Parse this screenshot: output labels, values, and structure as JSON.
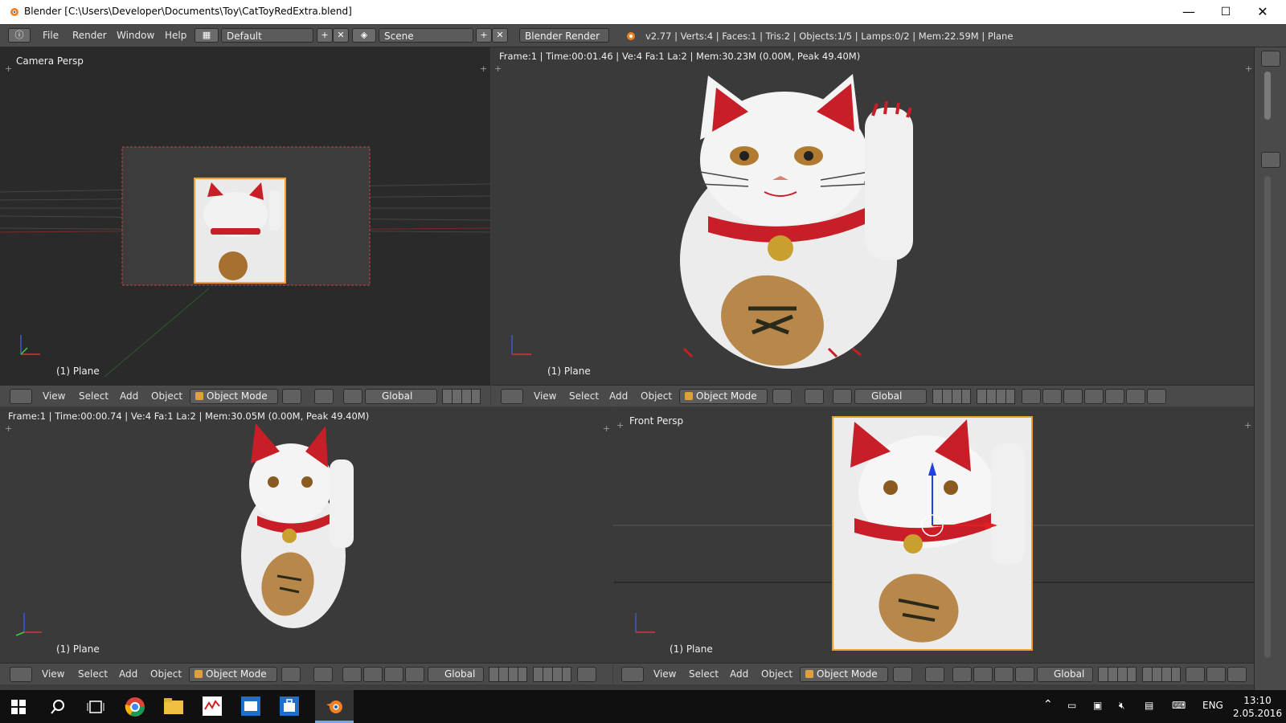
{
  "window": {
    "title": "Blender [C:\\Users\\Developer\\Documents\\Toy\\CatToyRedExtra.blend]",
    "minimize": "—",
    "maximize": "☐",
    "close": "✕"
  },
  "info_header": {
    "menus": [
      "File",
      "Render",
      "Window",
      "Help"
    ],
    "screen_layout": "Default",
    "scene": "Scene",
    "render_engine": "Blender Render",
    "stats": "v2.77 | Verts:4 | Faces:1 | Tris:2 | Objects:1/5 | Lamps:0/2 | Mem:22.59M | Plane"
  },
  "viewports": {
    "top_left": {
      "label": "Camera Persp",
      "object": "(1) Plane"
    },
    "top_right": {
      "render_info": "Frame:1 | Time:00:01.46 | Ve:4 Fa:1 La:2 | Mem:30.23M (0.00M, Peak 49.40M)",
      "object": "(1) Plane"
    },
    "bottom_left": {
      "render_info": "Frame:1 | Time:00:00.74 | Ve:4 Fa:1 La:2 | Mem:30.05M (0.00M, Peak 49.40M)",
      "object": "(1) Plane"
    },
    "bottom_right": {
      "label": "Front Persp",
      "object": "(1) Plane"
    }
  },
  "view_header": {
    "menus": [
      "View",
      "Select",
      "Add",
      "Object"
    ],
    "mode": "Object Mode",
    "orientation": "Global"
  },
  "taskbar": {
    "language": "ENG",
    "time": "13:10",
    "date": "2.05.2016"
  },
  "colors": {
    "accent_orange": "#f0a030",
    "cat_red": "#c81e28",
    "taskbar_bg": "#101010"
  }
}
